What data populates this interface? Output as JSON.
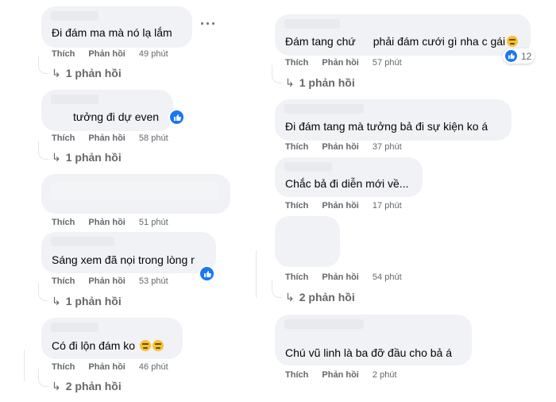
{
  "actions": {
    "like": "Thích",
    "reply": "Phản hồi"
  },
  "left": [
    {
      "text": "Đi đám ma mà nó lạ lắm",
      "time": "49 phút",
      "replies": "1 phản hồi"
    },
    {
      "text": "tưởng đi dự even",
      "time": "58 phút",
      "replies": "1 phản hồi"
    },
    {
      "text": "",
      "time": "51 phút"
    },
    {
      "text": "Sáng xem đã nọi trong lòng r",
      "time": "53 phút",
      "replies": "1 phản hồi"
    },
    {
      "text": "Có đi lộn đám ko",
      "time": "46 phút",
      "replies": "2 phản hồi"
    }
  ],
  "right": [
    {
      "text_a": "Đám tang chứ",
      "text_b": "phải đám cưới gì nha c gái",
      "time": "57 phút",
      "reaction_count": "12",
      "replies": "1 phản hồi"
    },
    {
      "text": "Đi đám tang mà tưởng bả đi sự kiện ko á",
      "time": "37 phút"
    },
    {
      "text": "Chắc bả đi diễn mới về...",
      "time": "17 phút"
    },
    {
      "text": "",
      "time": "54 phút",
      "replies": "2 phản hồi"
    },
    {
      "text": "Chú vũ linh là ba đỡ đầu cho bả á",
      "time": "2 phút"
    }
  ],
  "colors": {
    "bubble": "#f0f2f5",
    "meta": "#65676b",
    "like_blue": "#1877f2"
  },
  "icons": {
    "more": "more-options-icon",
    "like": "like-reaction-icon",
    "emoji": "smile-emoji-icon",
    "reply_arrow": "reply-arrow-icon"
  }
}
